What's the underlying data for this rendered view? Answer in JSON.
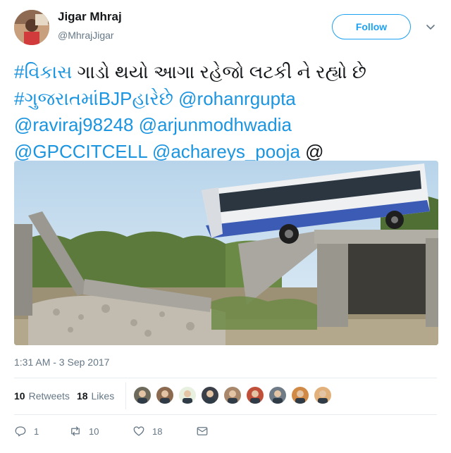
{
  "user": {
    "display_name": "Jigar Mhraj",
    "handle": "@MhrajJigar",
    "avatar_icon": "avatar-photo"
  },
  "follow_button": {
    "label": "Follow"
  },
  "menu_icon": "chevron-down-icon",
  "tweet": {
    "lines": [
      [
        {
          "text": "#વિકાસ",
          "link": true
        },
        {
          "text": " ગાડો થયો આગા રહેજો લટકી ને રહ્યો છે",
          "link": false
        }
      ],
      [
        {
          "text": "#ગુજરાતમાંBJPહારેછે",
          "link": true
        },
        {
          "text": " ",
          "link": false
        },
        {
          "text": "@rohanrgupta",
          "link": true
        }
      ],
      [
        {
          "text": "@raviraj98248",
          "link": true
        },
        {
          "text": " ",
          "link": false
        },
        {
          "text": "@arjunmodhwadia",
          "link": true
        }
      ],
      [
        {
          "text": "@GPCCITCELL",
          "link": true
        },
        {
          "text": " ",
          "link": false
        },
        {
          "text": "@achareys_pooja",
          "link": true
        },
        {
          "text": " @",
          "link": false
        }
      ]
    ],
    "image_icon": "bus-hanging-off-bridge-photo",
    "timestamp": "1:31 AM - 3 Sep 2017"
  },
  "stats": {
    "retweets_count": "10",
    "retweets_label": "Retweets",
    "likes_count": "18",
    "likes_label": "Likes"
  },
  "likers": [
    {
      "icon": "liker-avatar-1",
      "color": "#6d6a5c"
    },
    {
      "icon": "liker-avatar-2",
      "color": "#8b6a4f"
    },
    {
      "icon": "liker-avatar-3",
      "color": "#e8f0e0"
    },
    {
      "icon": "liker-avatar-4",
      "color": "#3b3f48"
    },
    {
      "icon": "liker-avatar-5",
      "color": "#a8876a"
    },
    {
      "icon": "liker-avatar-6",
      "color": "#c0503a"
    },
    {
      "icon": "liker-avatar-7",
      "color": "#6f7b86"
    },
    {
      "icon": "liker-avatar-8",
      "color": "#d08a45"
    },
    {
      "icon": "liker-avatar-9",
      "color": "#e2b07a"
    }
  ],
  "actions": {
    "reply_count": "1",
    "retweet_count": "10",
    "like_count": "18"
  },
  "colors": {
    "link": "#1b95e0",
    "follow": "#1da1f2",
    "muted": "#657786"
  }
}
